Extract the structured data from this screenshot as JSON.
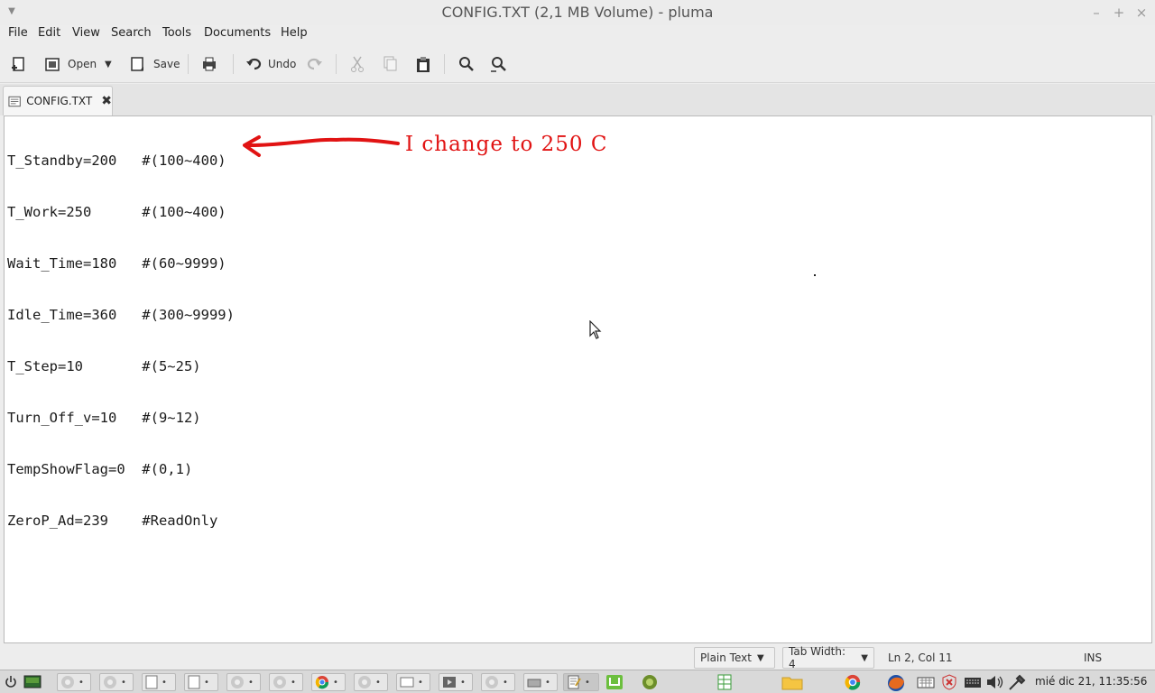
{
  "window": {
    "title": "CONFIG.TXT (2,1 MB Volume) - pluma",
    "controls": [
      "–",
      "+",
      "×"
    ]
  },
  "menu": [
    "File",
    "Edit",
    "View",
    "Search",
    "Tools",
    "Documents",
    "Help"
  ],
  "toolbar": {
    "open_label": "Open",
    "save_label": "Save",
    "undo_label": "Undo"
  },
  "tab": {
    "label": "CONFIG.TXT",
    "close": "✖"
  },
  "document": {
    "lines": [
      "T_Standby=200   #(100~400)",
      "T_Work=250      #(100~400)",
      "Wait_Time=180   #(60~9999)",
      "Idle_Time=360   #(300~9999)",
      "T_Step=10       #(5~25)",
      "Turn_Off_v=10   #(9~12)",
      "TempShowFlag=0  #(0,1)",
      "ZeroP_Ad=239    #ReadOnly"
    ],
    "annotation": "I change to 250  C",
    "annotation_color": "#e11313"
  },
  "statusbar": {
    "syntax": "Plain Text",
    "tab_width": "Tab Width:  4",
    "position": "Ln 2, Col 11",
    "mode": "INS"
  },
  "panel": {
    "clock": "mié dic 21, 11:35:56"
  }
}
